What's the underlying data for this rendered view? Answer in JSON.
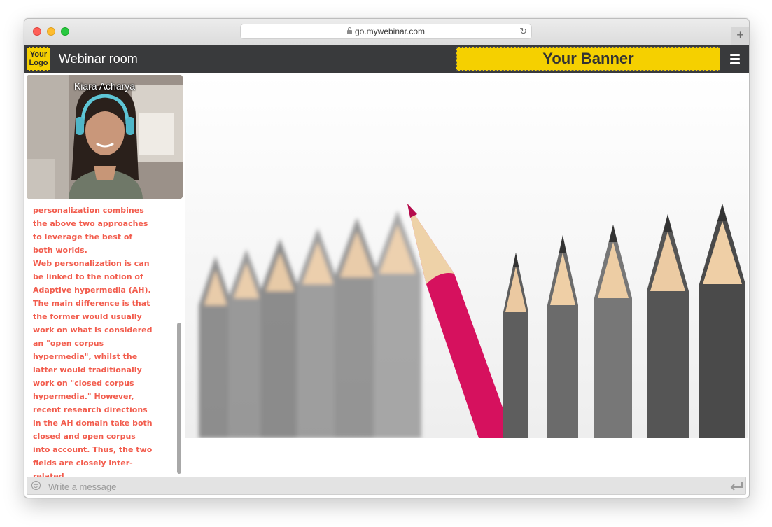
{
  "browser": {
    "url": "go.mywebinar.com",
    "newtab_symbol": "+"
  },
  "header": {
    "logo_text": "Your Logo",
    "room_title": "Webinar room",
    "banner_text": "Your Banner"
  },
  "video": {
    "speaker_name": "Kiara Acharya"
  },
  "chat": {
    "lines": [
      "personalization combines the above two approaches to leverage the best of both worlds.",
      "Web personalization is can be linked to the notion of Adaptive hypermedia (AH). The main difference is that the former would usually work on what is considered an \"open corpus hypermedia\", whilst the latter would traditionally work on \"closed corpus hypermedia.\" However, recent research directions in the AH domain take both closed and open corpus into account. Thus, the two fields are closely inter-related."
    ]
  },
  "message_bar": {
    "placeholder": "Write a message"
  },
  "colors": {
    "topbar": "#393a3c",
    "banner": "#f5d000",
    "chat_text": "#f25c4d",
    "accent_pencil": "#d6115e"
  }
}
